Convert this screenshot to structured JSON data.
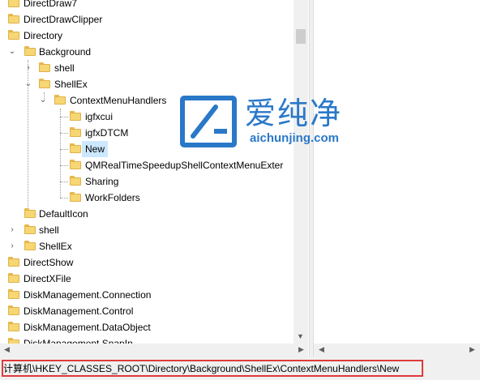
{
  "tree": {
    "items": [
      {
        "label": "DirectDraw7"
      },
      {
        "label": "DirectDrawClipper"
      },
      {
        "label": "Directory"
      },
      {
        "label": "Background"
      },
      {
        "label": "shell"
      },
      {
        "label": "ShellEx"
      },
      {
        "label": "ContextMenuHandlers"
      },
      {
        "label": "igfxcui"
      },
      {
        "label": "igfxDTCM"
      },
      {
        "label": "New",
        "selected": true
      },
      {
        "label": "QMRealTimeSpeedupShellContextMenuExter"
      },
      {
        "label": "Sharing"
      },
      {
        "label": "WorkFolders"
      },
      {
        "label": "DefaultIcon"
      },
      {
        "label": "shell"
      },
      {
        "label": "ShellEx"
      },
      {
        "label": "DirectShow"
      },
      {
        "label": "DirectXFile"
      },
      {
        "label": "DiskManagement.Connection"
      },
      {
        "label": "DiskManagement.Control"
      },
      {
        "label": "DiskManagement.DataObject"
      },
      {
        "label": "DiskManagement.SnapIn"
      }
    ]
  },
  "status_bar": {
    "path": "计算机\\HKEY_CLASSES_ROOT\\Directory\\Background\\ShellEx\\ContextMenuHandlers\\New"
  },
  "watermark": {
    "cn_text": "爱纯净",
    "url": "aichunjing.com"
  },
  "colors": {
    "selection": "#cce8ff",
    "highlight_border": "#e03a3a",
    "watermark": "#2a78c8"
  },
  "icons": {
    "folder": "folder-icon",
    "expanded": "chevron-down-icon",
    "collapsed": "chevron-right-icon"
  }
}
